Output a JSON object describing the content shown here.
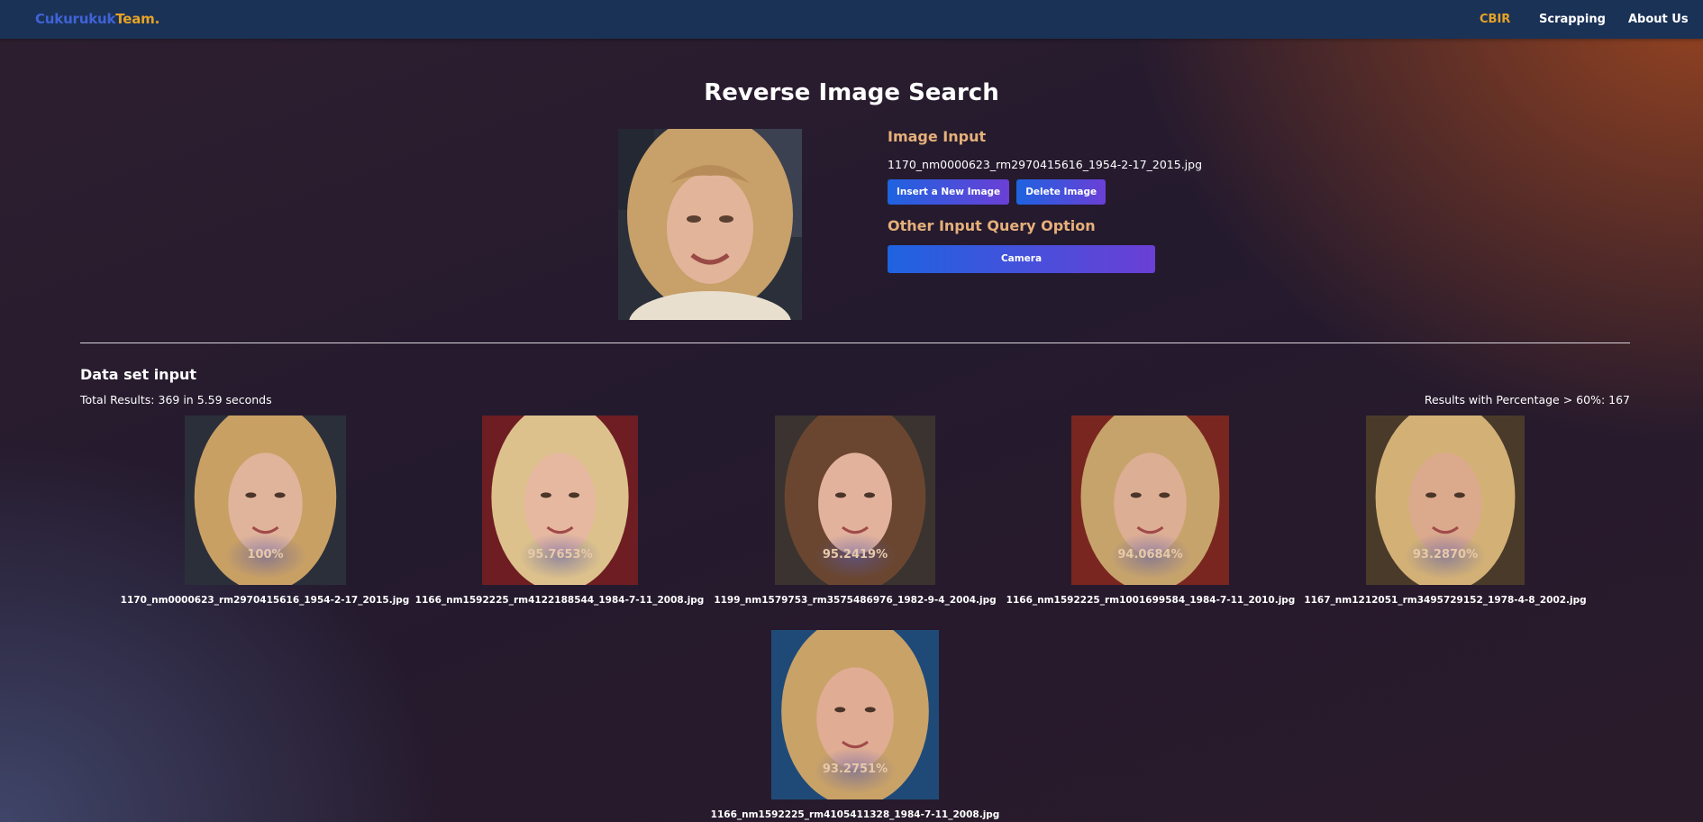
{
  "brand": {
    "part1": "Cukurukuk",
    "part2": "Team."
  },
  "nav": [
    {
      "label": "CBIR",
      "active": true
    },
    {
      "label": "Scrapping",
      "active": false
    },
    {
      "label": "About Us",
      "active": false
    }
  ],
  "page_title": "Reverse Image Search",
  "input_panel": {
    "heading": "Image Input",
    "filename": "1170_nm0000623_rm2970415616_1954-2-17_2015.jpg",
    "insert_label": "Insert a New Image",
    "delete_label": "Delete Image",
    "other_heading": "Other Input Query Option",
    "camera_label": "Camera"
  },
  "dataset": {
    "heading": "Data set input",
    "total": "Total Results: 369 in 5.59 seconds",
    "pct_summary": "Results with Percentage > 60%: 167"
  },
  "results": [
    {
      "percent": "100%",
      "filename": "1170_nm0000623_rm2970415616_1954-2-17_2015.jpg",
      "hair": "#c9a064",
      "bg": "#2b2f3a",
      "skin": "#e0b49a"
    },
    {
      "percent": "95.7653%",
      "filename": "1166_nm1592225_rm4122188544_1984-7-11_2008.jpg",
      "hair": "#dcc18c",
      "bg": "#6e1d22",
      "skin": "#e6b8a0"
    },
    {
      "percent": "95.2419%",
      "filename": "1199_nm1579753_rm3575486976_1982-9-4_2004.jpg",
      "hair": "#6a4630",
      "bg": "#3a3330",
      "skin": "#e2b29c"
    },
    {
      "percent": "94.0684%",
      "filename": "1166_nm1592225_rm1001699584_1984-7-11_2010.jpg",
      "hair": "#c7a36c",
      "bg": "#7a2620",
      "skin": "#dcae94"
    },
    {
      "percent": "93.2870%",
      "filename": "1167_nm1212051_rm3495729152_1978-4-8_2002.jpg",
      "hair": "#d3b176",
      "bg": "#4a3a2a",
      "skin": "#dba98c"
    },
    {
      "percent": "93.2751%",
      "filename": "1166_nm1592225_rm4105411328_1984-7-11_2008.jpg",
      "hair": "#c9a268",
      "bg": "#1f4a78",
      "skin": "#e0ad94"
    }
  ]
}
